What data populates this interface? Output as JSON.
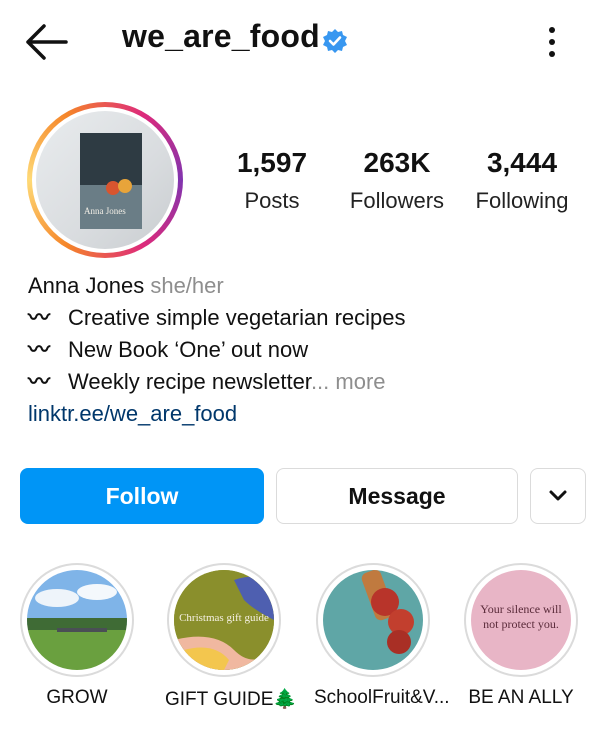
{
  "header": {
    "username": "we_are_food",
    "icons": {
      "back": "arrow-left-icon",
      "verified": "verified-badge-icon",
      "options": "more-vertical-icon"
    },
    "colors": {
      "verified": "#3897f0"
    }
  },
  "profile": {
    "stats": [
      {
        "value": "1,597",
        "label": "Posts"
      },
      {
        "value": "263K",
        "label": "Followers"
      },
      {
        "value": "3,444",
        "label": "Following"
      }
    ],
    "avatar": {
      "book_title": "Anna Jones"
    }
  },
  "bio": {
    "name": "Anna Jones",
    "pronouns": "she/her",
    "lines": [
      {
        "prefix": "〰",
        "text": "Creative simple vegetarian recipes"
      },
      {
        "prefix": "〰",
        "text": "New Book ‘One’ out now"
      },
      {
        "prefix": "〰",
        "text": "Weekly recipe newsletter"
      }
    ],
    "truncation": "... more",
    "link": "linktr.ee/we_are_food"
  },
  "actions": {
    "follow_label": "Follow",
    "message_label": "Message",
    "more_icon": "chevron-down-icon",
    "colors": {
      "follow_bg": "#0095f6"
    }
  },
  "highlights": [
    {
      "label": "GROW"
    },
    {
      "label": "GIFT GUIDE🌲",
      "image_text": "Christmas gift guide"
    },
    {
      "label": "SchoolFruit&V..."
    },
    {
      "label": "BE AN ALLY",
      "image_text": "Your silence will not protect you."
    }
  ]
}
